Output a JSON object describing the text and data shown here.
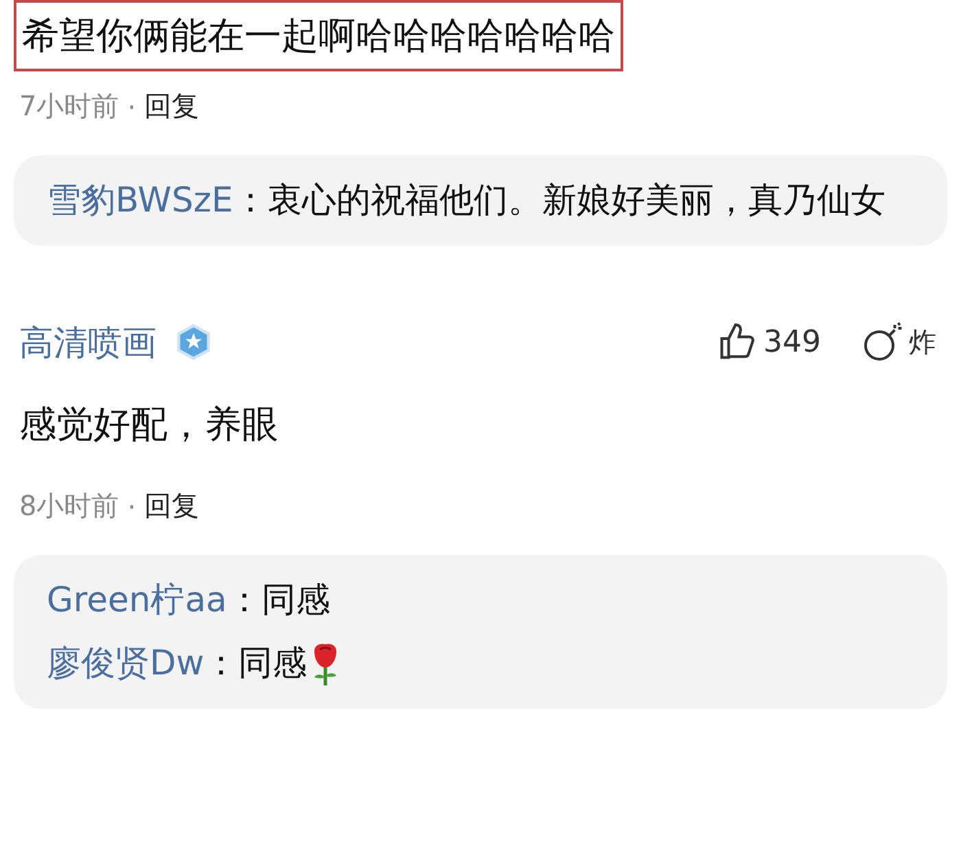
{
  "comments": [
    {
      "text": "希望你俩能在一起啊哈哈哈哈哈哈哈",
      "highlighted": true,
      "time": "7小时前",
      "separator": "·",
      "reply_label": "回复",
      "replies": [
        {
          "user": "雪豹BWSzE",
          "text": "：衷心的祝福他们。新娘好美丽，真乃仙女",
          "emoji": false
        }
      ]
    },
    {
      "author": "高清喷画",
      "verified": true,
      "likes": "349",
      "bomb_label": "炸",
      "text": "感觉好配，养眼",
      "highlighted": false,
      "time": "8小时前",
      "separator": "·",
      "reply_label": "回复",
      "replies": [
        {
          "user": "Green柠aa",
          "text": "：同感",
          "emoji": false
        },
        {
          "user": "廖俊贤Dw",
          "text": "：同感",
          "emoji": true
        }
      ]
    }
  ]
}
